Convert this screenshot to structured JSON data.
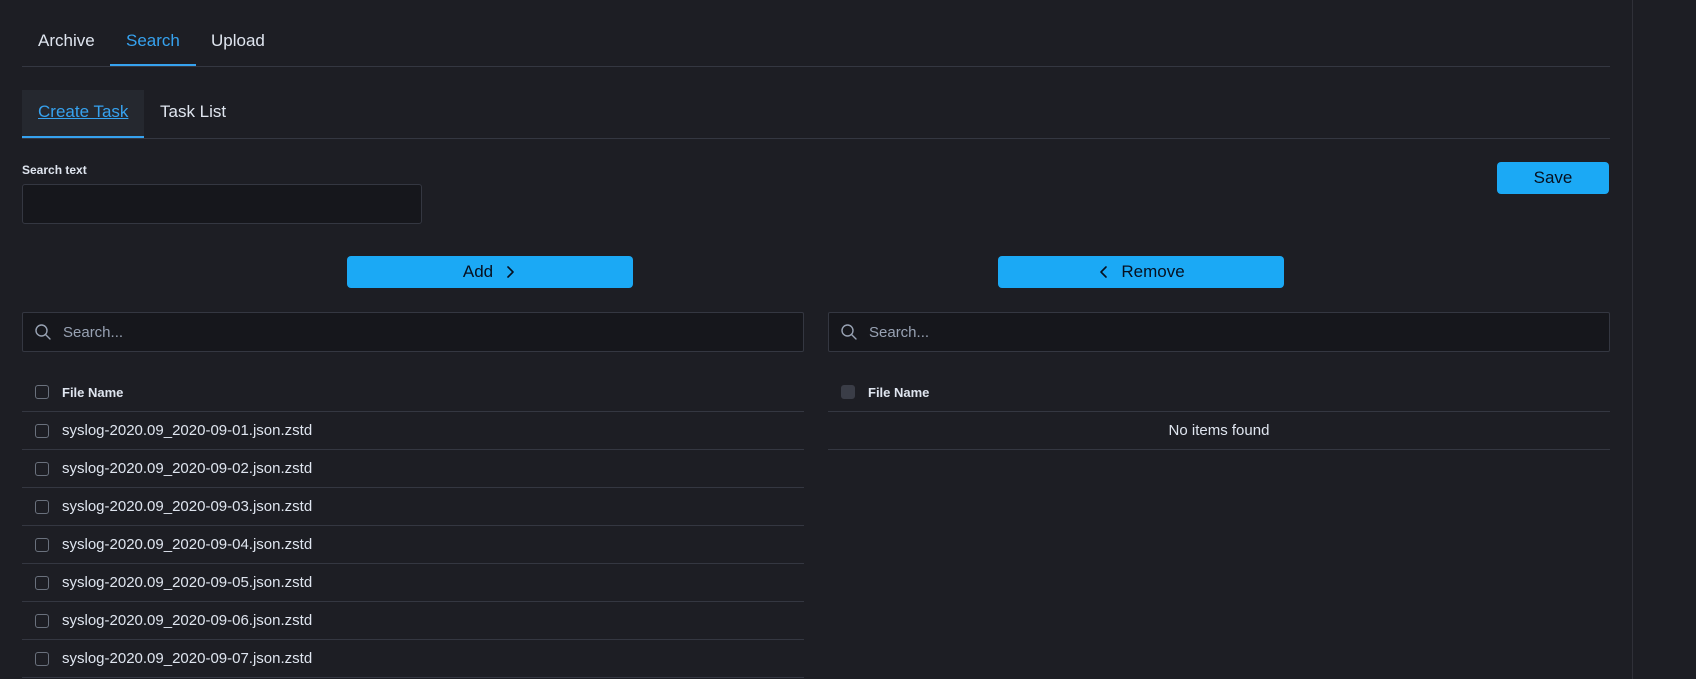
{
  "tabs": [
    {
      "label": "Archive",
      "active": false
    },
    {
      "label": "Search",
      "active": true
    },
    {
      "label": "Upload",
      "active": false
    }
  ],
  "subtabs": [
    {
      "label": "Create Task",
      "active": true
    },
    {
      "label": "Task List",
      "active": false
    }
  ],
  "form": {
    "search_text_label": "Search text",
    "search_text_value": "",
    "save_label": "Save"
  },
  "transfer": {
    "add_label": "Add",
    "remove_label": "Remove",
    "left": {
      "search_placeholder": "Search...",
      "column_header": "File Name",
      "rows": [
        "syslog-2020.09_2020-09-01.json.zstd",
        "syslog-2020.09_2020-09-02.json.zstd",
        "syslog-2020.09_2020-09-03.json.zstd",
        "syslog-2020.09_2020-09-04.json.zstd",
        "syslog-2020.09_2020-09-05.json.zstd",
        "syslog-2020.09_2020-09-06.json.zstd",
        "syslog-2020.09_2020-09-07.json.zstd"
      ]
    },
    "right": {
      "search_placeholder": "Search...",
      "column_header": "File Name",
      "empty_message": "No items found"
    }
  },
  "colors": {
    "background": "#1d1e24",
    "accent": "#36a2ef",
    "button": "#1ba9f5"
  }
}
